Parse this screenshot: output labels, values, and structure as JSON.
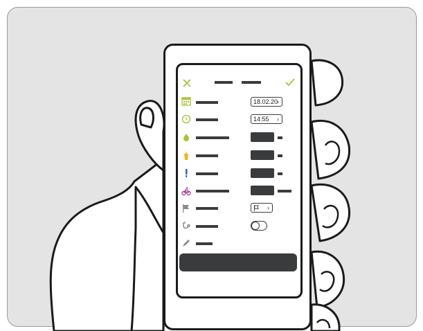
{
  "form": {
    "date_value": "18.02.20",
    "time_value": "14:55"
  },
  "colors": {
    "accent_green": "#a8c23b",
    "accent_purple": "#9a2d8e",
    "accent_blue": "#2f5fc7",
    "accent_orange": "#f0b51c",
    "placeholder": "#3a3b3d"
  },
  "icons": [
    "close-icon",
    "checkmark-icon",
    "calendar-icon",
    "clock-icon",
    "drop-icon",
    "apple-icon",
    "syringe-icon",
    "bike-icon",
    "flag-icon",
    "stethoscope-icon",
    "pen-icon"
  ]
}
